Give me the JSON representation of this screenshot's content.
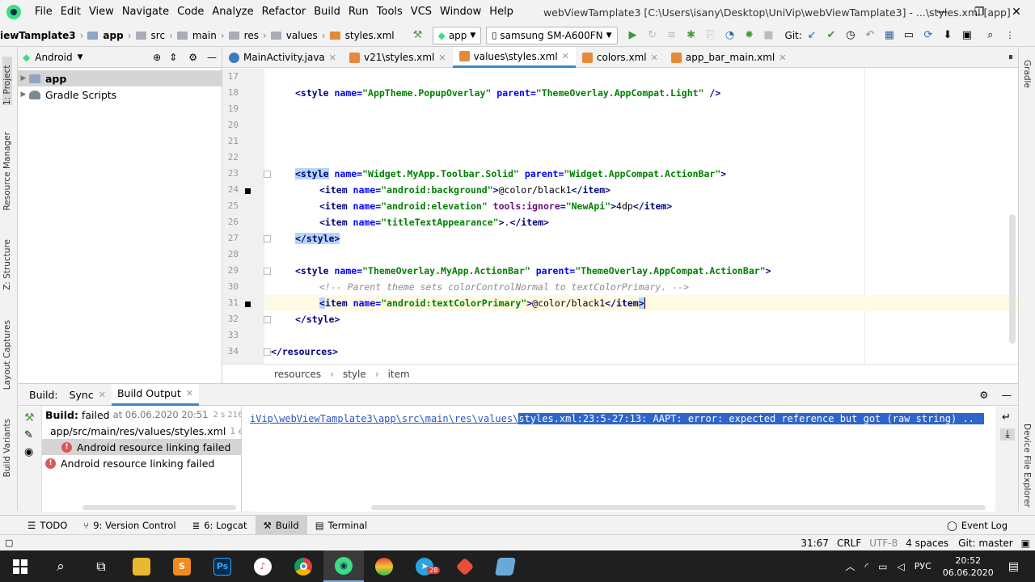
{
  "menubar": {
    "items": [
      "File",
      "Edit",
      "View",
      "Navigate",
      "Code",
      "Analyze",
      "Refactor",
      "Build",
      "Run",
      "Tools",
      "VCS",
      "Window",
      "Help"
    ],
    "title": "webViewTamplate3 [C:\\Users\\isany\\Desktop\\UniVip\\webViewTamplate3] - ...\\styles.xml [app]"
  },
  "navbar": {
    "crumbs": [
      "iewTamplate3",
      "app",
      "src",
      "main",
      "res",
      "values",
      "styles.xml"
    ],
    "run_config": "app",
    "device": "samsung SM-A600FN",
    "git_label": "Git:"
  },
  "left_toolwindows": [
    "1: Project",
    "Resource Manager",
    "Z: Structure",
    "Layout Captures",
    "Build Variants"
  ],
  "right_toolwindows": [
    "Gradle",
    "Device File Explorer"
  ],
  "project": {
    "view": "Android",
    "items": [
      {
        "label": "app"
      },
      {
        "label": "Gradle Scripts"
      }
    ]
  },
  "editor": {
    "tabs": [
      {
        "label": "MainActivity.java",
        "color": "#3b7ac2"
      },
      {
        "label": "v21\\styles.xml",
        "color": "#e58a3a"
      },
      {
        "label": "values\\styles.xml",
        "color": "#e58a3a"
      },
      {
        "label": "colors.xml",
        "color": "#e58a3a"
      },
      {
        "label": "app_bar_main.xml",
        "color": "#e58a3a"
      }
    ],
    "line_numbers": [
      "17",
      "18",
      "19",
      "20",
      "21",
      "22",
      "23",
      "24",
      "25",
      "26",
      "27",
      "28",
      "29",
      "30",
      "31",
      "32",
      "33",
      "34"
    ],
    "code": {
      "l18": {
        "a1": "name",
        "v1": "\"AppTheme.PopupOverlay\"",
        "a2": "parent",
        "v2": "\"ThemeOverlay.AppCompat.Light\""
      },
      "l23": {
        "v1": "\"Widget.MyApp.Toolbar.Solid\"",
        "v2": "\"Widget.AppCompat.ActionBar\""
      },
      "l24": {
        "v": "\"android:background\"",
        "text": "@color/black1"
      },
      "l25": {
        "v": "\"android:elevation\"",
        "a2": "tools:ignore",
        "v2": "\"NewApi\"",
        "text": "4dp"
      },
      "l26": {
        "v": "\"titleTextAppearance\"",
        "text": "."
      },
      "l29": {
        "v1": "\"ThemeOverlay.MyApp.ActionBar\"",
        "v2": "\"ThemeOverlay.AppCompat.ActionBar\""
      },
      "l30": {
        "comment": "<!-- Parent theme sets colorControlNormal to textColorPrimary. -->"
      },
      "l31": {
        "v": "\"android:textColorPrimary\"",
        "text": "@color/black1"
      }
    },
    "breadcrumb": [
      "resources",
      "style",
      "item"
    ]
  },
  "build": {
    "tabs": [
      "Build:",
      "Sync",
      "Build Output"
    ],
    "tree": {
      "root_label": "Build:",
      "root_status": "failed",
      "root_time": "at 06.06.2020 20:51",
      "root_duration": "2 s 216 ms",
      "file": "app/src/main/res/values/styles.xml",
      "file_errors": "1 error",
      "error1": "Android resource linking failed",
      "error2": "Android resource linking failed"
    },
    "output": {
      "path": "iVip\\webViewTamplate3\\app\\src\\main\\res\\values\\",
      "msg": "styles.xml:23:5-27:13: AAPT: error: expected reference but got (raw string) .."
    }
  },
  "bottom_tabs": [
    {
      "label": "TODO"
    },
    {
      "label": "9: Version Control"
    },
    {
      "label": "6: Logcat"
    },
    {
      "label": "Build"
    },
    {
      "label": "Terminal"
    }
  ],
  "event_log": "Event Log",
  "status": {
    "position": "31:67",
    "line_sep": "CRLF",
    "encoding": "UTF-8",
    "indent": "4 spaces",
    "git": "Git: master"
  },
  "taskbar": {
    "lang": "РУС",
    "time": "20:52",
    "date": "06.06.2020",
    "badge": "28"
  }
}
